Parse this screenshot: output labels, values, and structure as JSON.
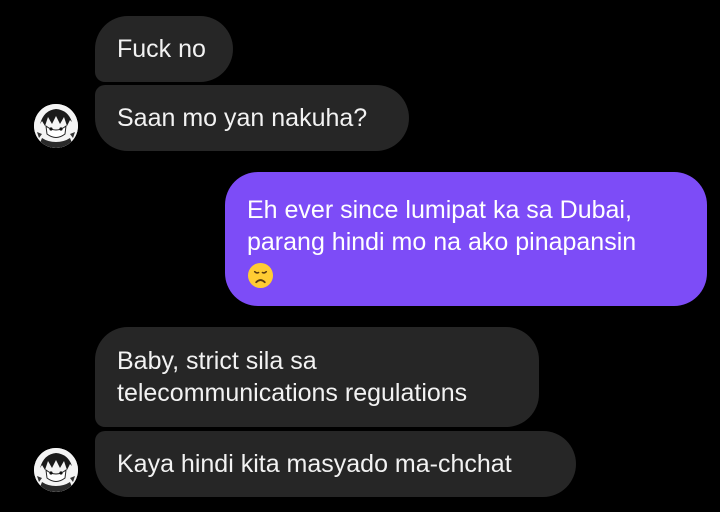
{
  "conversation": {
    "messages": [
      {
        "sender": "them",
        "text": "Fuck no"
      },
      {
        "sender": "them",
        "text": "Saan mo yan nakuha?"
      },
      {
        "sender": "me",
        "lines": [
          "Eh ever since lumipat ka sa Dubai,",
          "parang hindi mo na ako pinapansin"
        ],
        "emoji": "disappointed-face"
      },
      {
        "sender": "them",
        "lines": [
          "Baby, strict sila sa",
          "telecommunications regulations"
        ]
      },
      {
        "sender": "them",
        "text": "Kaya hindi kita masyado ma-chchat"
      }
    ]
  },
  "colors": {
    "background": "#000000",
    "incoming_bubble": "#262626",
    "outgoing_bubble": "#7d4cf7",
    "text": "#f2f2f2"
  },
  "icons": {
    "avatar": "contact-avatar-manga-portrait",
    "emoji": "disappointed-face"
  }
}
